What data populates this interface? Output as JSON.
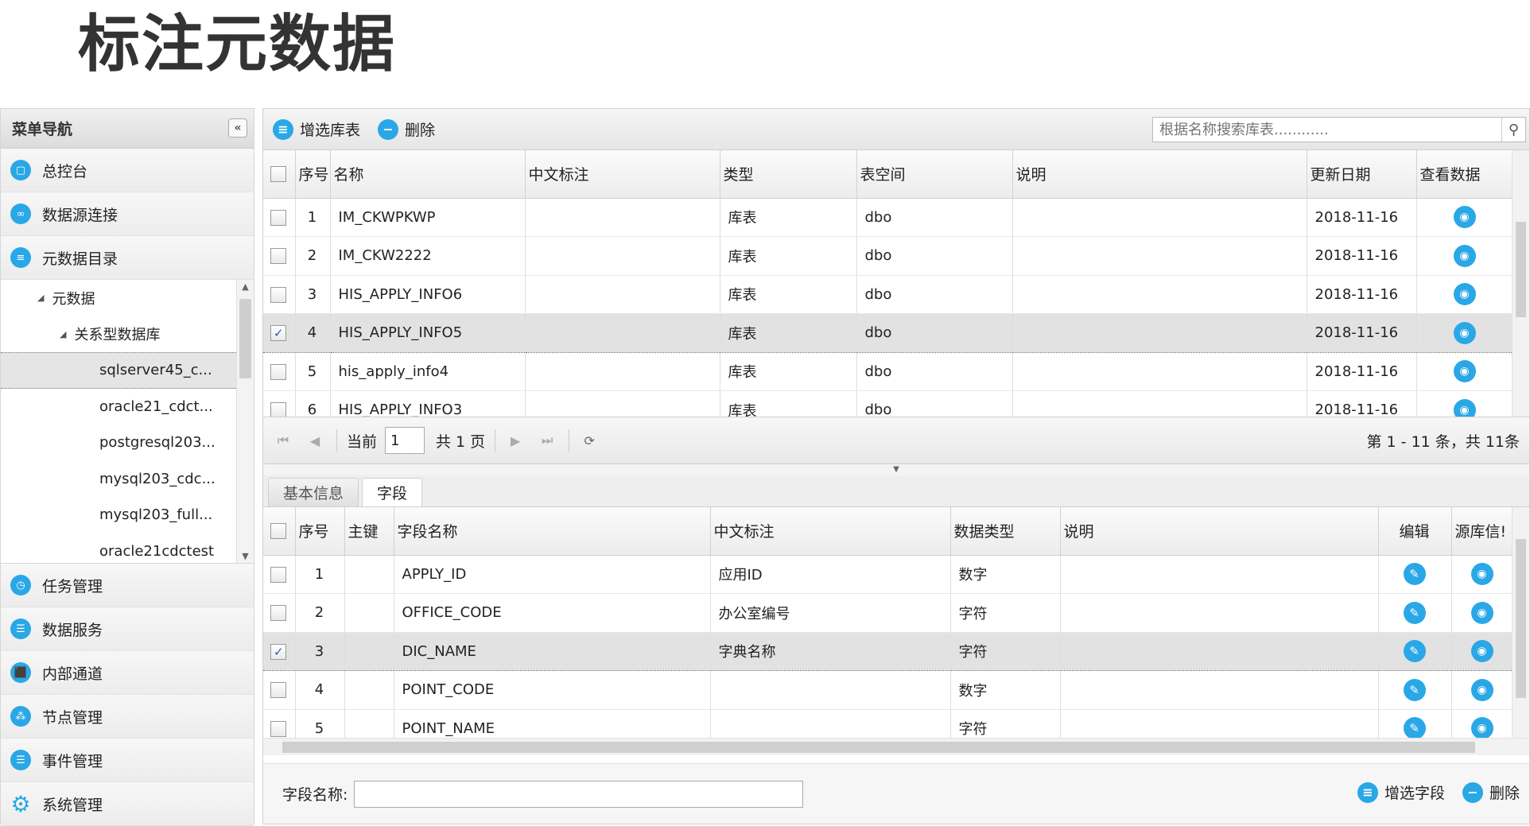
{
  "page_title": "标注元数据",
  "sidebar": {
    "title": "菜单导航",
    "collapse_label": "«",
    "top_items": [
      {
        "label": "总控台"
      },
      {
        "label": "数据源连接"
      },
      {
        "label": "元数据目录"
      }
    ],
    "tree": [
      {
        "label": "元数据",
        "level": 1,
        "caret": "◢"
      },
      {
        "label": "关系型数据库",
        "level": 2,
        "caret": "◢"
      },
      {
        "label": "sqlserver45_c...",
        "level": 3,
        "selected": true
      },
      {
        "label": "oracle21_cdct...",
        "level": 3
      },
      {
        "label": "postgresql203...",
        "level": 3
      },
      {
        "label": "mysql203_cdc...",
        "level": 3
      },
      {
        "label": "mysql203_full...",
        "level": 3
      },
      {
        "label": "oracle21cdctest",
        "level": 3
      }
    ],
    "bottom_items": [
      {
        "label": "任务管理"
      },
      {
        "label": "数据服务"
      },
      {
        "label": "内部通道"
      },
      {
        "label": "节点管理"
      },
      {
        "label": "事件管理"
      },
      {
        "label": "系统管理"
      }
    ]
  },
  "toolbar": {
    "add_label": "增选库表",
    "delete_label": "删除",
    "search_placeholder": "根据名称搜索库表............"
  },
  "table_grid": {
    "headers": [
      "序号",
      "名称",
      "中文标注",
      "类型",
      "表空间",
      "说明",
      "更新日期",
      "查看数据"
    ],
    "rows": [
      {
        "no": "1",
        "name": "IM_CKWPKWP",
        "cn": "",
        "type": "库表",
        "space": "dbo",
        "desc": "",
        "date": "2018-11-16",
        "checked": false
      },
      {
        "no": "2",
        "name": "IM_CKW2222",
        "cn": "",
        "type": "库表",
        "space": "dbo",
        "desc": "",
        "date": "2018-11-16",
        "checked": false
      },
      {
        "no": "3",
        "name": "HIS_APPLY_INFO6",
        "cn": "",
        "type": "库表",
        "space": "dbo",
        "desc": "",
        "date": "2018-11-16",
        "checked": false
      },
      {
        "no": "4",
        "name": "HIS_APPLY_INFO5",
        "cn": "",
        "type": "库表",
        "space": "dbo",
        "desc": "",
        "date": "2018-11-16",
        "checked": true
      },
      {
        "no": "5",
        "name": "his_apply_info4",
        "cn": "",
        "type": "库表",
        "space": "dbo",
        "desc": "",
        "date": "2018-11-16",
        "checked": false
      },
      {
        "no": "6",
        "name": "HIS_APPLY_INFO3",
        "cn": "",
        "type": "库表",
        "space": "dbo",
        "desc": "",
        "date": "2018-11-16",
        "checked": false
      }
    ]
  },
  "pager": {
    "current_label": "当前",
    "page_value": "1",
    "total_label": "共 1 页",
    "info": "第 1 - 11 条，共 11条"
  },
  "tabs": [
    {
      "label": "基本信息",
      "active": false
    },
    {
      "label": "字段",
      "active": true
    }
  ],
  "field_grid": {
    "headers": [
      "序号",
      "主键",
      "字段名称",
      "中文标注",
      "数据类型",
      "说明",
      "编辑",
      "源库信!"
    ],
    "rows": [
      {
        "no": "1",
        "pk": "",
        "name": "APPLY_ID",
        "cn": "应用ID",
        "dtype": "数字",
        "desc": "",
        "checked": false
      },
      {
        "no": "2",
        "pk": "",
        "name": "OFFICE_CODE",
        "cn": "办公室编号",
        "dtype": "字符",
        "desc": "",
        "checked": false
      },
      {
        "no": "3",
        "pk": "",
        "name": "DIC_NAME",
        "cn": "字典名称",
        "dtype": "字符",
        "desc": "",
        "checked": true
      },
      {
        "no": "4",
        "pk": "",
        "name": "POINT_CODE",
        "cn": "",
        "dtype": "数字",
        "desc": "",
        "checked": false
      },
      {
        "no": "5",
        "pk": "",
        "name": "POINT_NAME",
        "cn": "",
        "dtype": "字符",
        "desc": "",
        "checked": false
      }
    ]
  },
  "bottom_bar": {
    "field_name_label": "字段名称:",
    "field_name_value": "",
    "add_field_label": "增选字段",
    "delete_label": "删除"
  },
  "colors": {
    "accent": "#2aa7e6"
  }
}
